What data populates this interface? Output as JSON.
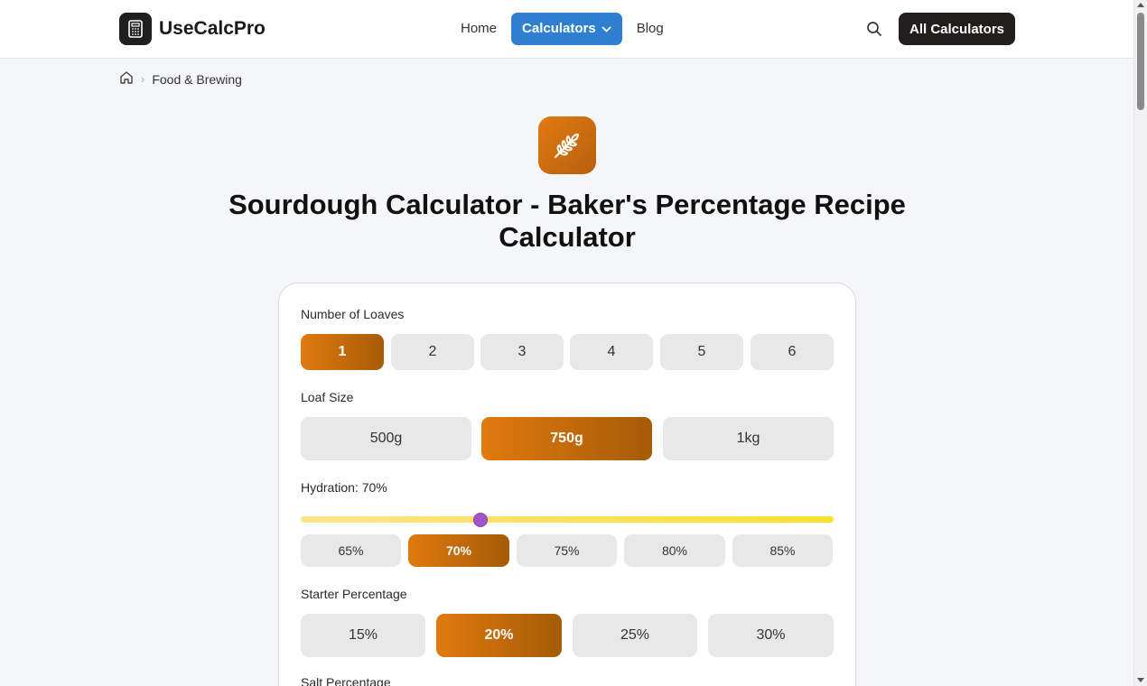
{
  "header": {
    "logo_text": "UseCalcPro",
    "nav": {
      "home": "Home",
      "calculators": "Calculators",
      "blog": "Blog"
    },
    "all_calculators": "All Calculators"
  },
  "breadcrumb": {
    "category": "Food & Brewing"
  },
  "hero": {
    "title": "Sourdough Calculator - Baker's Percentage Recipe Calculator",
    "icon": "wheat-icon",
    "accent_color": "#e07a12"
  },
  "calculator": {
    "loaves": {
      "label": "Number of Loaves",
      "options": [
        "1",
        "2",
        "3",
        "4",
        "5",
        "6"
      ],
      "selected": "1"
    },
    "loaf_size": {
      "label": "Loaf Size",
      "options": [
        "500g",
        "750g",
        "1kg"
      ],
      "selected": "750g"
    },
    "hydration": {
      "label": "Hydration: 70%",
      "value": 70,
      "min": 60,
      "max": 90,
      "presets": [
        "65%",
        "70%",
        "75%",
        "80%",
        "85%"
      ],
      "selected": "70%"
    },
    "starter": {
      "label": "Starter Percentage",
      "options": [
        "15%",
        "20%",
        "25%",
        "30%"
      ],
      "selected": "20%"
    },
    "salt": {
      "label": "Salt Percentage"
    }
  }
}
